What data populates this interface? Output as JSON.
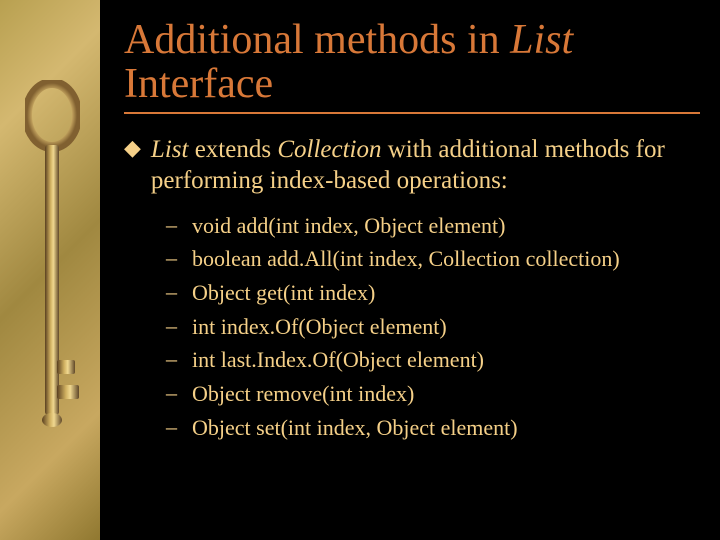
{
  "slide": {
    "title_part1": "Additional methods in ",
    "title_italic": "List",
    "title_part2": " Interface",
    "bullet": {
      "seg1_italic": "List",
      "seg2": " extends ",
      "seg3_italic": "Collection",
      "seg4": " with additional methods for performing index-based operations:"
    },
    "subitems": [
      "void add(int index, Object element)",
      "boolean add.All(int index, Collection collection)",
      "Object get(int index)",
      "int index.Of(Object element)",
      "int last.Index.Of(Object element)",
      "Object remove(int index)",
      "Object set(int index, Object element)"
    ]
  }
}
